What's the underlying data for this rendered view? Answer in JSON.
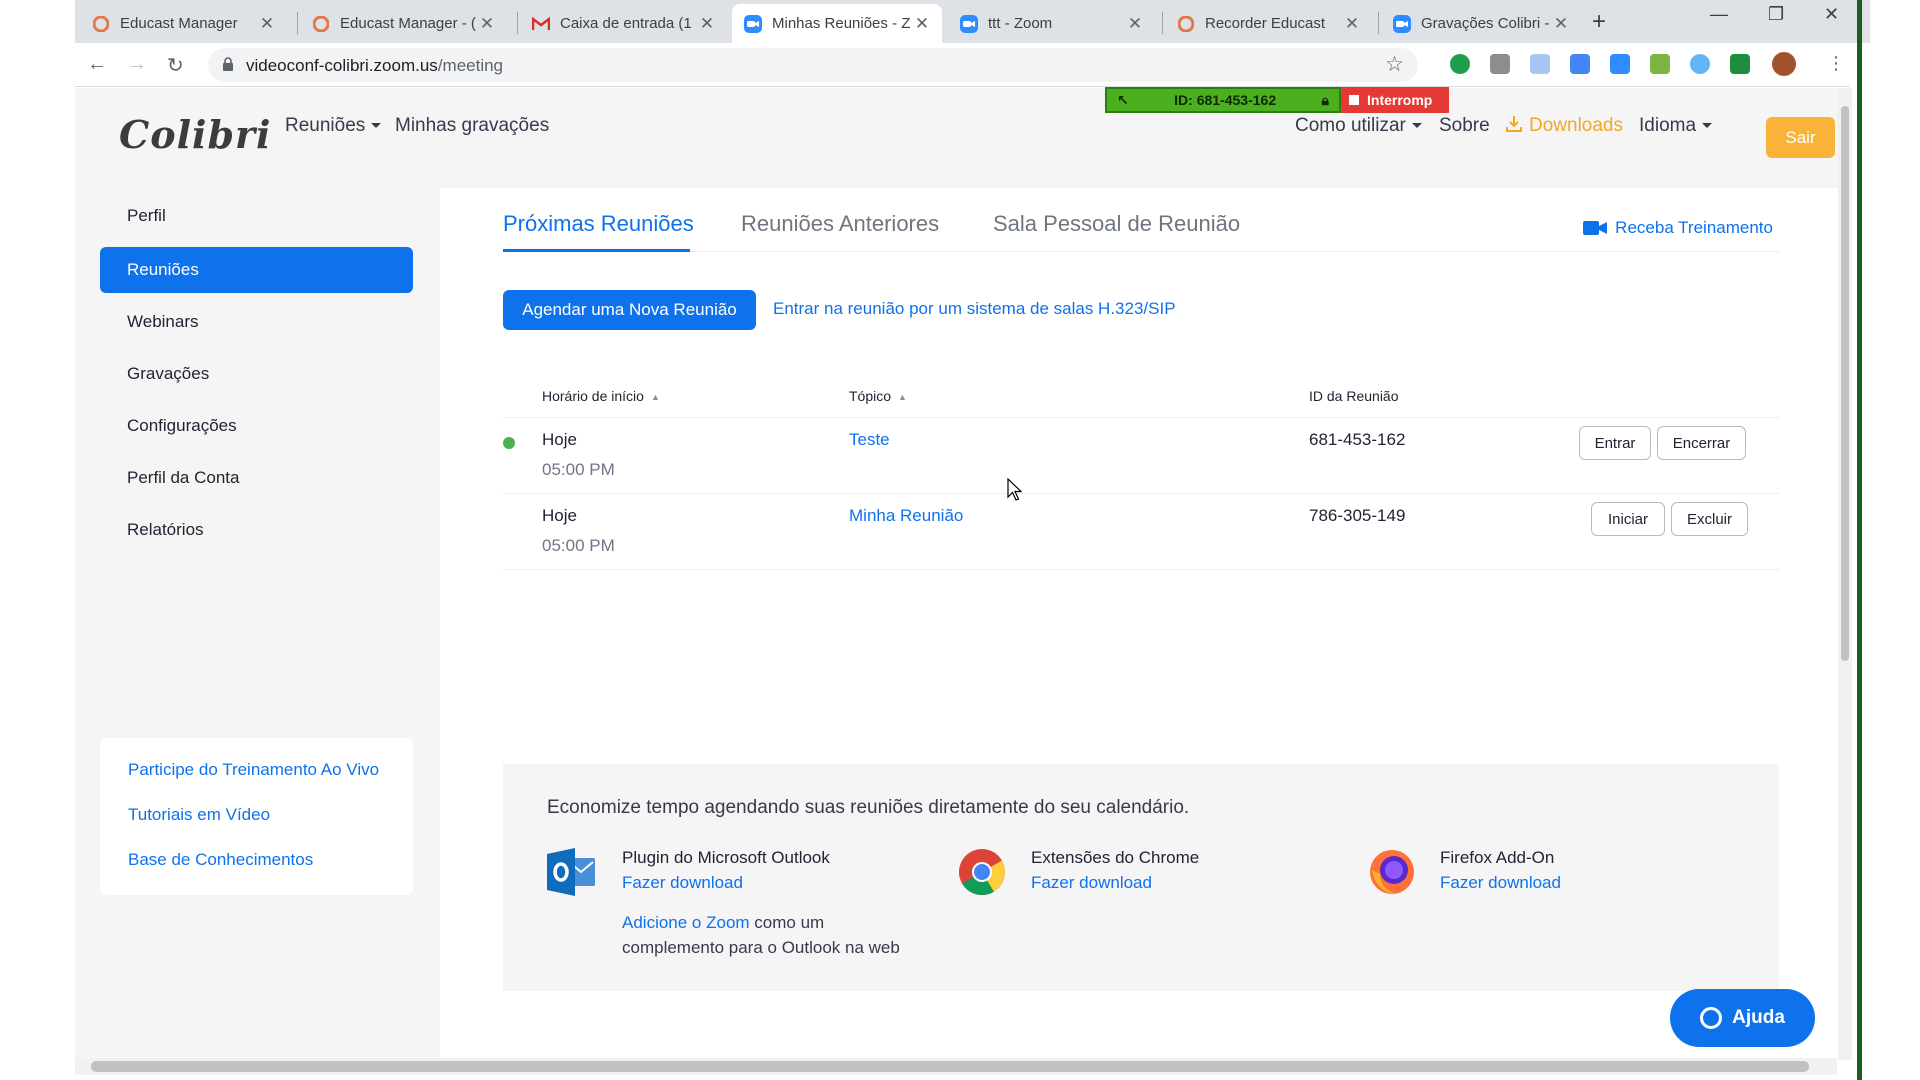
{
  "browser": {
    "tabs": [
      {
        "title": "Educast Manager",
        "icon": "educast-icon"
      },
      {
        "title": "Educast Manager - (",
        "icon": "educast-icon"
      },
      {
        "title": "Caixa de entrada (1",
        "icon": "gmail-icon"
      },
      {
        "title": "Minhas Reuniões - Z",
        "icon": "zoom-icon",
        "active": true
      },
      {
        "title": "ttt - Zoom",
        "icon": "zoom-icon"
      },
      {
        "title": "Recorder Educast",
        "icon": "educast-icon"
      },
      {
        "title": "Gravações Colibri - ",
        "icon": "zoom-icon"
      }
    ],
    "url_host": "videoconf-colibri.zoom.us",
    "url_path": "/meeting"
  },
  "recorder": {
    "id_label": "ID: 681-453-162",
    "stop_label": "Interromp"
  },
  "header": {
    "logo": "Colibri",
    "nav_meetings": "Reuniões",
    "nav_recordings": "Minhas gravações",
    "nav_howto": "Como utilizar",
    "nav_about": "Sobre",
    "nav_downloads": "Downloads",
    "nav_language": "Idioma",
    "logout": "Sair"
  },
  "sidebar": {
    "items": [
      {
        "label": "Perfil"
      },
      {
        "label": "Reuniões",
        "active": true
      },
      {
        "label": "Webinars"
      },
      {
        "label": "Gravações"
      },
      {
        "label": "Configurações"
      },
      {
        "label": "Perfil da Conta"
      },
      {
        "label": "Relatórios"
      }
    ],
    "help_links": [
      "Participe do Treinamento Ao Vivo",
      "Tutoriais em Vídeo",
      "Base de Conhecimentos"
    ]
  },
  "main": {
    "tabs": [
      {
        "label": "Próximas Reuniões",
        "active": true
      },
      {
        "label": "Reuniões Anteriores"
      },
      {
        "label": "Sala Pessoal de Reunião"
      }
    ],
    "training_link": "Receba Treinamento",
    "schedule_button": "Agendar uma Nova Reunião",
    "sip_link": "Entrar na reunião por um sistema de salas H.323/SIP",
    "table": {
      "headers": {
        "start": "Horário de início",
        "topic": "Tópico",
        "id": "ID da Reunião"
      },
      "rows": [
        {
          "day": "Hoje",
          "time": "05:00 PM",
          "topic": "Teste",
          "id": "681-453-162",
          "live": true,
          "action1": "Entrar",
          "action2": "Encerrar"
        },
        {
          "day": "Hoje",
          "time": "05:00 PM",
          "topic": "Minha Reunião",
          "id": "786-305-149",
          "live": false,
          "action1": "Iniciar",
          "action2": "Excluir"
        }
      ]
    },
    "promo": {
      "title": "Economize tempo agendando suas reuniões diretamente do seu calendário.",
      "outlook_title": "Plugin do Microsoft Outlook",
      "outlook_link": "Fazer download",
      "outlook_extra_link": "Adicione o Zoom",
      "outlook_extra_text1": " como um",
      "outlook_extra_text2": "complemento para o Outlook na web",
      "chrome_title": "Extensões do Chrome",
      "chrome_link": "Fazer download",
      "firefox_title": "Firefox Add-On",
      "firefox_link": "Fazer download"
    },
    "help_button": "Ajuda"
  },
  "colors": {
    "accent": "#0e72ed",
    "downloads": "#f5a623",
    "logout": "#f9b339",
    "live_dot": "#4caf50"
  }
}
